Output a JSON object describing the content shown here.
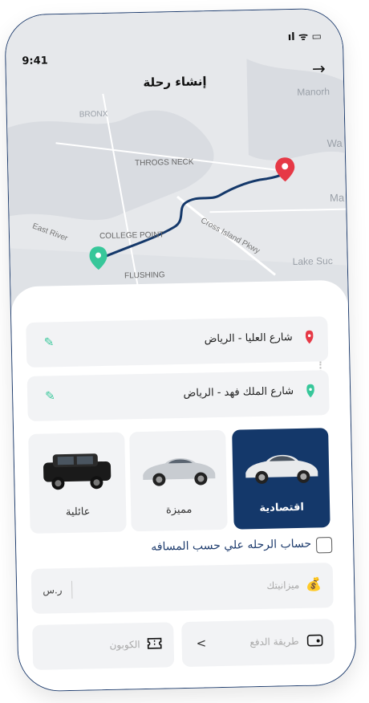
{
  "status": {
    "time": "9:41",
    "icons": "ıl ᯤ ▭"
  },
  "header": {
    "title": "إنشاء رحلة",
    "back_glyph": "→"
  },
  "map_labels": {
    "bronx": "BRONX",
    "manor": "Manorh",
    "wa": "Wa",
    "throgs": "THROGS NECK",
    "ma": "Ma",
    "east_river": "East River",
    "college_point": "COLLEGE POINT",
    "cross_island": "Cross Island Pkwy",
    "lake": "Lake Suc",
    "flushing": "FLUSHING"
  },
  "locations": [
    {
      "text": "شارع العليا - الرياض",
      "pin_color": "#e63946"
    },
    {
      "text": "شارع الملك فهد - الرياض",
      "pin_color": "#37c79a"
    }
  ],
  "cars": [
    {
      "label": "عائلية",
      "selected": false
    },
    {
      "label": "مميزة",
      "selected": false
    },
    {
      "label": "اقتصادية",
      "selected": true
    }
  ],
  "distance_option": {
    "label": "حساب الرحله علي حسب المسافه",
    "checked": false
  },
  "budget": {
    "placeholder": "ميزانيتك",
    "currency": "ر.س"
  },
  "payment": {
    "placeholder": "طريقة الدفع",
    "chevron": "<"
  },
  "coupon": {
    "placeholder": "الكوبون"
  },
  "colors": {
    "primary": "#14386a",
    "accent_green": "#37c79a",
    "accent_red": "#e63946"
  }
}
